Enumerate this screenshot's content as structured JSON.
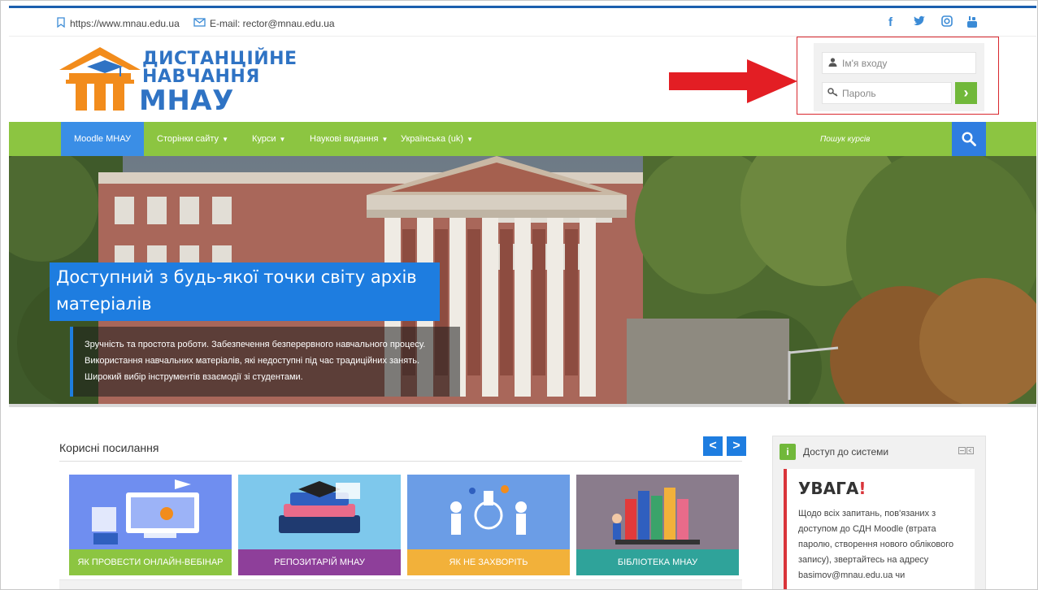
{
  "topbar": {
    "url": "https://www.mnau.edu.ua",
    "email": "E-mail: rector@mnau.edu.ua",
    "social": [
      "facebook-icon",
      "twitter-icon",
      "instagram-icon",
      "youtube-icon"
    ]
  },
  "logo": {
    "line1": "ДИСТАНЦІЙНЕ",
    "line2": "НАВЧАННЯ",
    "line3": "МНАУ",
    "colors": {
      "orange": "#f28c1c",
      "blue": "#2f73c4"
    }
  },
  "login": {
    "username_placeholder": "Ім'я входу",
    "password_placeholder": "Пароль",
    "submit_glyph": "›"
  },
  "nav": {
    "items": [
      {
        "label": "Moodle МНАУ",
        "dropdown": false,
        "active": true
      },
      {
        "label": "Сторінки сайту",
        "dropdown": true,
        "active": false
      },
      {
        "label": "Курси",
        "dropdown": true,
        "active": false
      },
      {
        "label": "Наукові видання",
        "dropdown": true,
        "active": false
      },
      {
        "label": "Українська (uk)",
        "dropdown": true,
        "active": false
      }
    ],
    "search_placeholder": "Пошук курсів",
    "color": "#8cc541"
  },
  "hero": {
    "title": "Доступний з будь-якої точки світу архів матеріалів",
    "lines": [
      "Зручність та простота роботи. Забезпечення безперервного навчального процесу.",
      "Використання навчальних матеріалів, які недоступні під час традиційних занять.",
      "Широкий вибір інструментів взаємодії зі студентами."
    ]
  },
  "links": {
    "title": "Корисні посилання",
    "prev": "<",
    "next": ">",
    "cards": [
      {
        "label": "Як провести онлайн-вебінар",
        "color": "#8cc541",
        "bg": "#6f8ef0"
      },
      {
        "label": "Репозитарій МНАУ",
        "color": "#8e3f9a",
        "bg": "#7ec8ec"
      },
      {
        "label": "Як не захворіть",
        "color": "#f2b13a",
        "bg": "#6b9de6"
      },
      {
        "label": "Бібліотека МНАУ",
        "color": "#2fa39a",
        "bg": "#8a7c8c"
      }
    ]
  },
  "side": {
    "title": "Доступ до системи",
    "warning": "УВАГА",
    "bang": "!",
    "text": "Щодо всіх запитань, пов'язаних з доступом до СДН Moodle (втрата паролю, створення нового облікового запису), звертайтесь на адресу basimov@mnau.edu.ua чи"
  }
}
